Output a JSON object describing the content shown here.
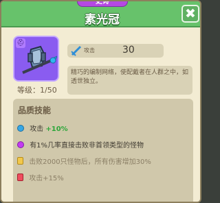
{
  "header": {
    "rarity": "史诗",
    "title": "素光冠",
    "close_label": "✖"
  },
  "item": {
    "icon": "helmet-with-spear-icon",
    "level_text": "等级：1/50"
  },
  "stat": {
    "icon": "attack-sword-icon",
    "label": "攻击",
    "value": "30"
  },
  "description": "精巧的编制网络，使配戴者在人群之中，如透世独立。",
  "skills": {
    "title": "品质技能",
    "lines": [
      {
        "icon": "blue-dot",
        "text": "攻击",
        "highlight": "+10%"
      },
      {
        "icon": "purple-dot",
        "text": "有1%几率直接击败非首领类型的怪物"
      },
      {
        "icon": "yellow-lock",
        "text": "击败2000只怪物后，所有伤害增加30%"
      },
      {
        "icon": "red-lock",
        "text": "攻击+15%"
      }
    ]
  },
  "colors": {
    "header_green": "#67c26b",
    "epic_purple": "#b548e3",
    "panel_bg": "#f3ecd3",
    "accent_blue": "#35a7e6"
  }
}
